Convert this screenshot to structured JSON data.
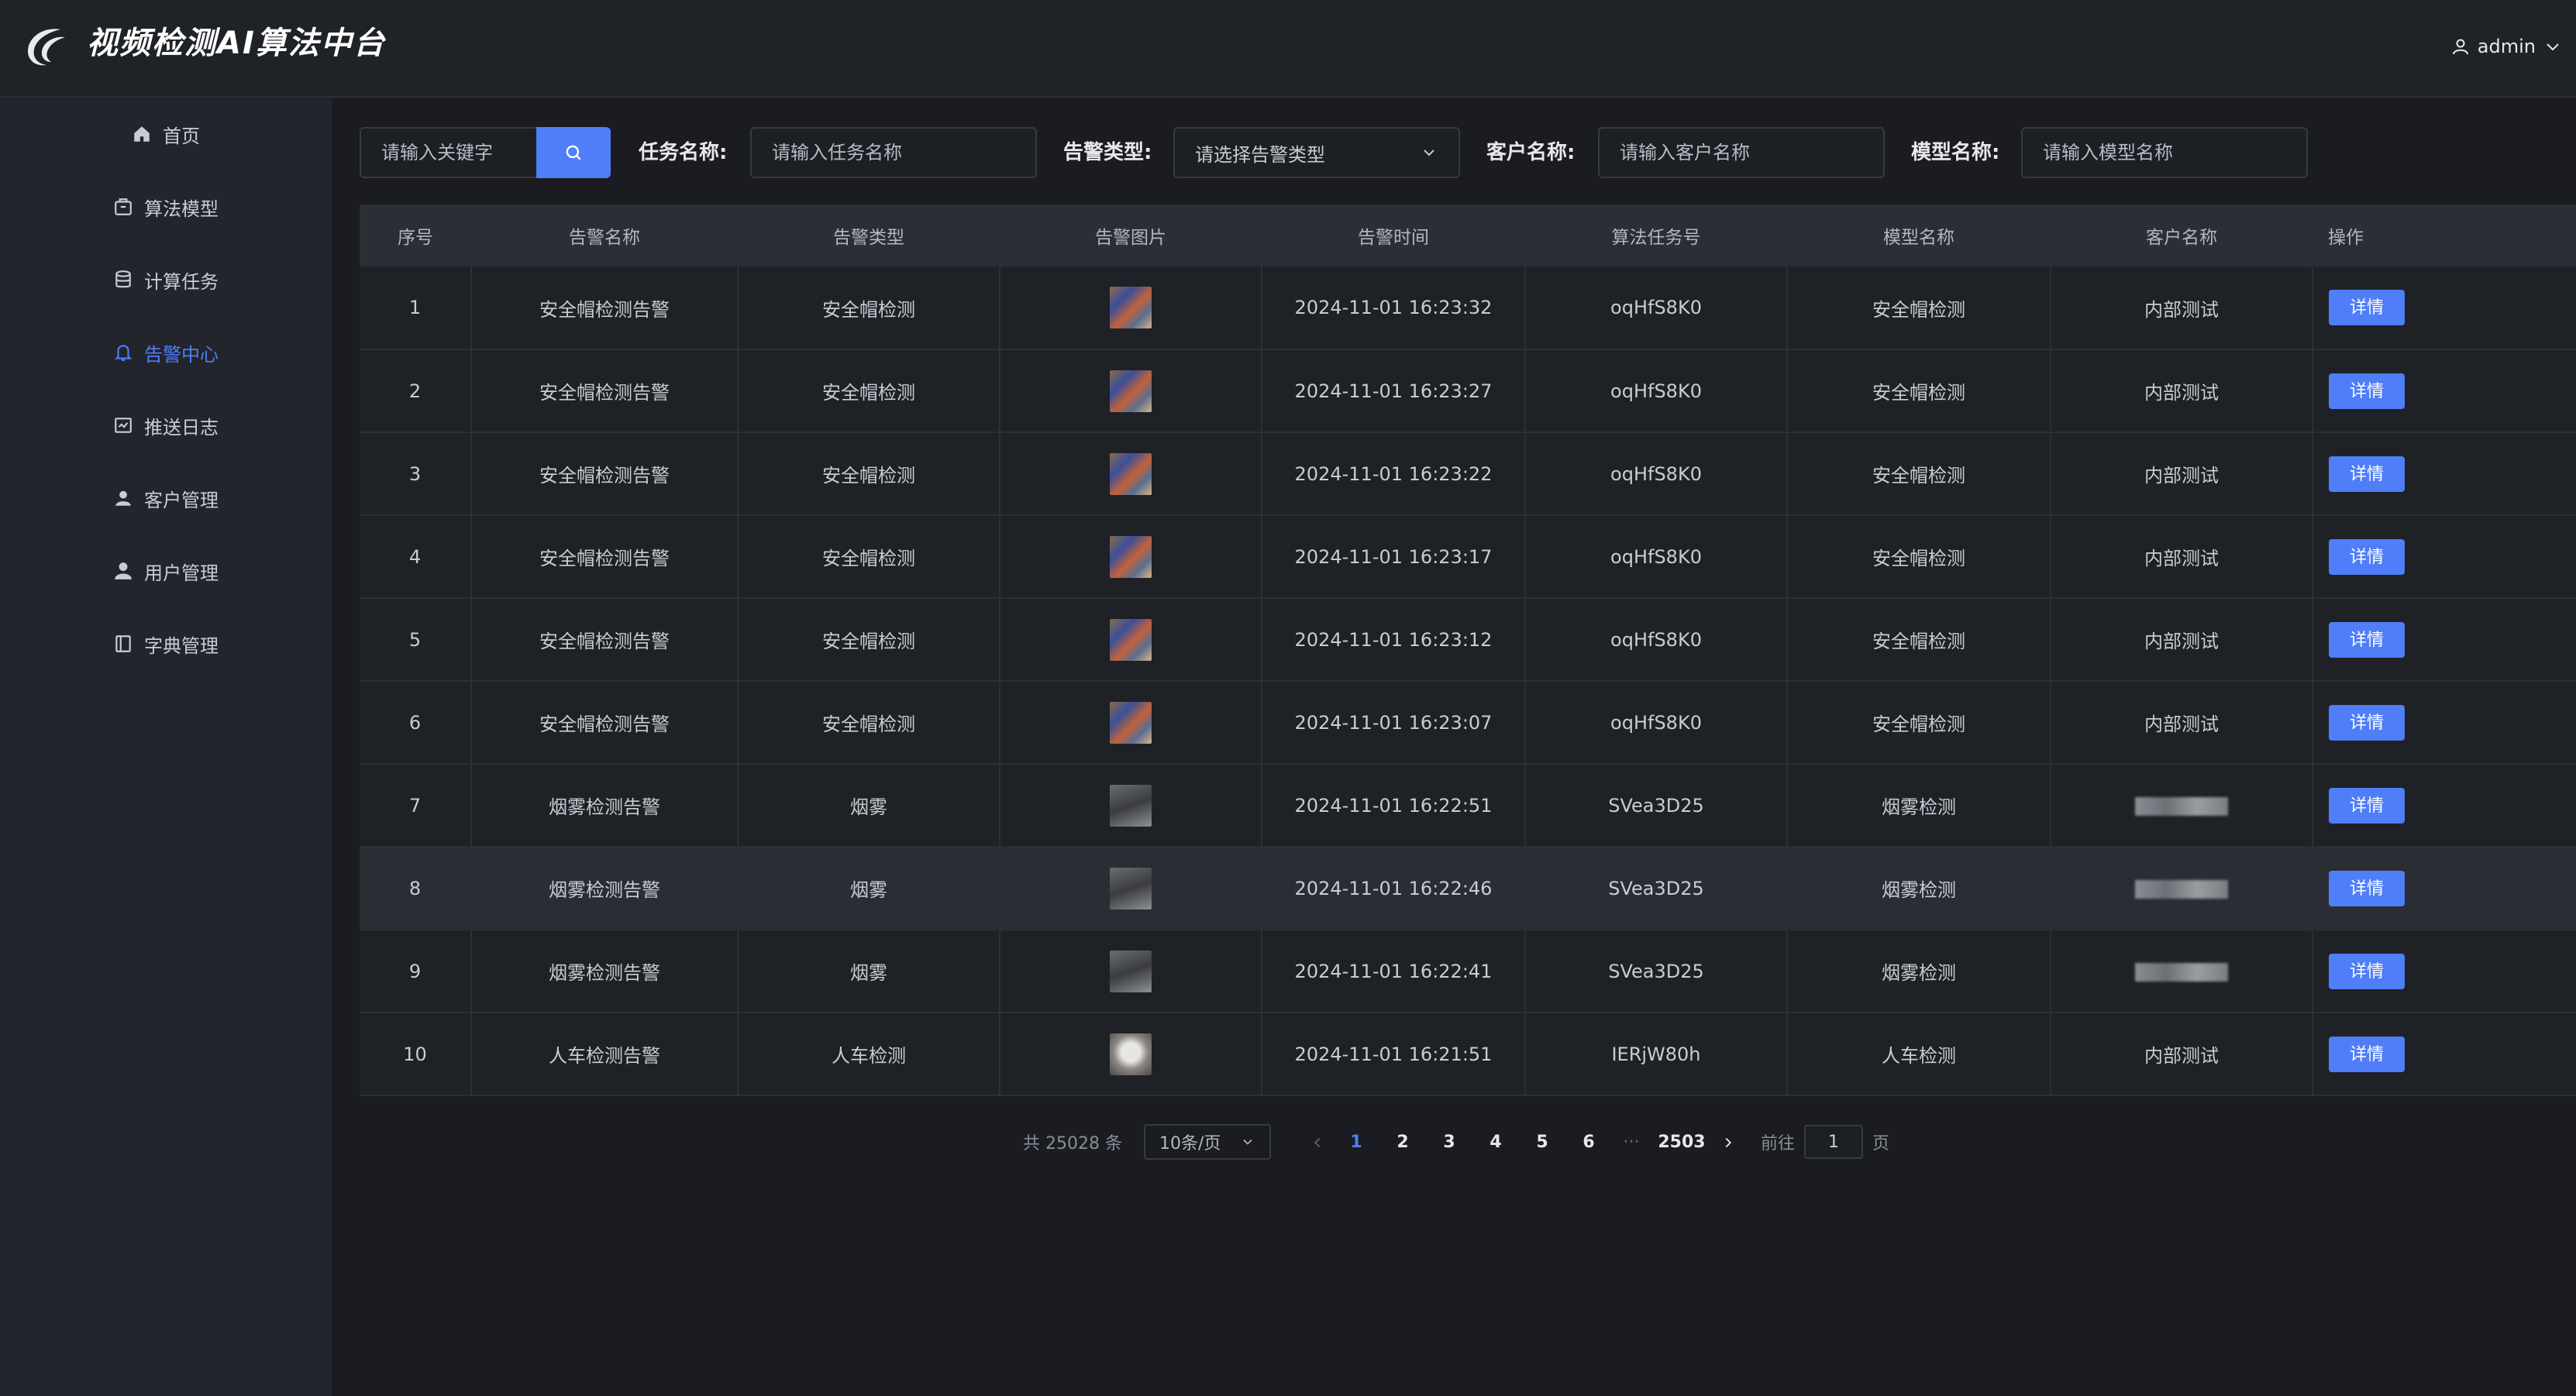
{
  "header": {
    "title": "视频检测AI算法中台",
    "user": "admin"
  },
  "sidebar": {
    "active_index": 3,
    "items": [
      {
        "label": "首页",
        "icon": "home-icon"
      },
      {
        "label": "算法模型",
        "icon": "cube-icon"
      },
      {
        "label": "计算任务",
        "icon": "database-icon"
      },
      {
        "label": "告警中心",
        "icon": "bell-icon"
      },
      {
        "label": "推送日志",
        "icon": "log-icon"
      },
      {
        "label": "客户管理",
        "icon": "person-icon"
      },
      {
        "label": "用户管理",
        "icon": "user-icon"
      },
      {
        "label": "字典管理",
        "icon": "book-icon"
      }
    ]
  },
  "filters": {
    "keyword_placeholder": "请输入关键字",
    "task_label": "任务名称:",
    "task_placeholder": "请输入任务名称",
    "alarm_type_label": "告警类型:",
    "alarm_type_placeholder": "请选择告警类型",
    "customer_label": "客户名称:",
    "customer_placeholder": "请输入客户名称",
    "model_label": "模型名称:",
    "model_placeholder": "请输入模型名称"
  },
  "table": {
    "columns": [
      "序号",
      "告警名称",
      "告警类型",
      "告警图片",
      "告警时间",
      "算法任务号",
      "模型名称",
      "客户名称",
      "操作"
    ],
    "detail_label": "详情",
    "rows": [
      {
        "no": "1",
        "name": "安全帽检测告警",
        "type": "安全帽检测",
        "image": "helmet",
        "time": "2024-11-01 16:23:32",
        "task": "oqHfS8K0",
        "model": "安全帽检测",
        "customer": "内部测试"
      },
      {
        "no": "2",
        "name": "安全帽检测告警",
        "type": "安全帽检测",
        "image": "helmet",
        "time": "2024-11-01 16:23:27",
        "task": "oqHfS8K0",
        "model": "安全帽检测",
        "customer": "内部测试"
      },
      {
        "no": "3",
        "name": "安全帽检测告警",
        "type": "安全帽检测",
        "image": "helmet",
        "time": "2024-11-01 16:23:22",
        "task": "oqHfS8K0",
        "model": "安全帽检测",
        "customer": "内部测试"
      },
      {
        "no": "4",
        "name": "安全帽检测告警",
        "type": "安全帽检测",
        "image": "helmet",
        "time": "2024-11-01 16:23:17",
        "task": "oqHfS8K0",
        "model": "安全帽检测",
        "customer": "内部测试"
      },
      {
        "no": "5",
        "name": "安全帽检测告警",
        "type": "安全帽检测",
        "image": "helmet",
        "time": "2024-11-01 16:23:12",
        "task": "oqHfS8K0",
        "model": "安全帽检测",
        "customer": "内部测试"
      },
      {
        "no": "6",
        "name": "安全帽检测告警",
        "type": "安全帽检测",
        "image": "helmet",
        "time": "2024-11-01 16:23:07",
        "task": "oqHfS8K0",
        "model": "安全帽检测",
        "customer": "内部测试"
      },
      {
        "no": "7",
        "name": "烟雾检测告警",
        "type": "烟雾",
        "image": "smoke",
        "time": "2024-11-01 16:22:51",
        "task": "SVea3D25",
        "model": "烟雾检测",
        "customer": null
      },
      {
        "no": "8",
        "name": "烟雾检测告警",
        "type": "烟雾",
        "image": "smoke",
        "time": "2024-11-01 16:22:46",
        "task": "SVea3D25",
        "model": "烟雾检测",
        "customer": null
      },
      {
        "no": "9",
        "name": "烟雾检测告警",
        "type": "烟雾",
        "image": "smoke",
        "time": "2024-11-01 16:22:41",
        "task": "SVea3D25",
        "model": "烟雾检测",
        "customer": null
      },
      {
        "no": "10",
        "name": "人车检测告警",
        "type": "人车检测",
        "image": "people",
        "time": "2024-11-01 16:21:51",
        "task": "IERjW80h",
        "model": "人车检测",
        "customer": "内部测试"
      }
    ],
    "highlighted_row": 8
  },
  "pagination": {
    "total": "共 25028 条",
    "page_size": "10条/页",
    "pages": [
      "1",
      "2",
      "3",
      "4",
      "5",
      "6"
    ],
    "dots": "···",
    "last": "2503",
    "current": "1",
    "goto_prefix": "前往",
    "goto_value": "1",
    "goto_suffix": "页"
  },
  "colors": {
    "accent": "#4f7ef8",
    "background": "#1a1c21",
    "sidebar": "#22252b"
  }
}
